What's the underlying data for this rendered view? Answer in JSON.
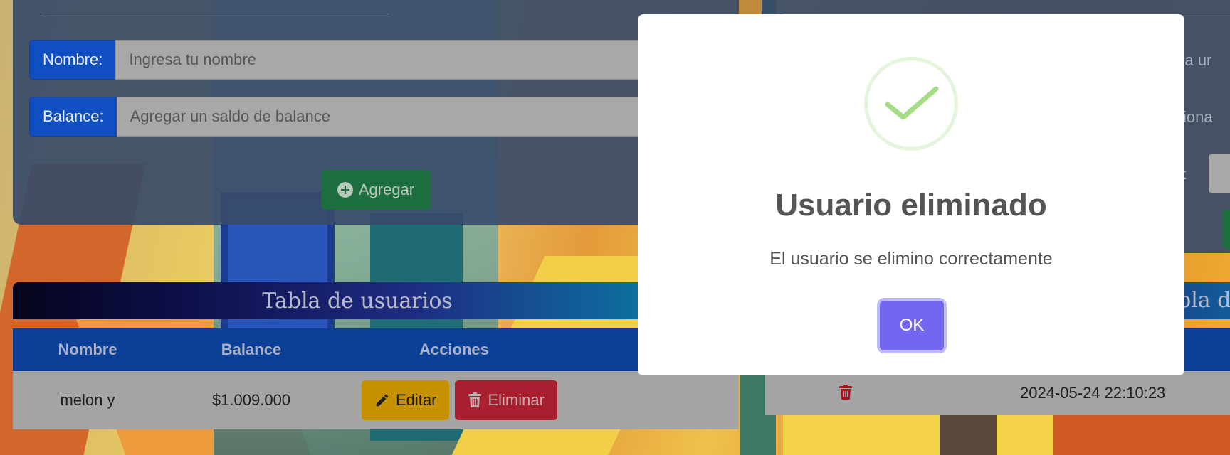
{
  "form": {
    "nombre_label": "Nombre:",
    "nombre_placeholder": "Ingresa tu nombre",
    "balance_label": "Balance:",
    "balance_placeholder": "Agregar un saldo de balance",
    "add_button": "Agregar",
    "add_icon": "plus-circle-icon"
  },
  "users_table": {
    "title": "Tabla de usuarios",
    "headers": [
      "Nombre",
      "Balance",
      "Acciones"
    ],
    "rows": [
      {
        "nombre": "melon y",
        "balance": "$1.009.000",
        "edit_label": "Editar",
        "delete_label": "Eliminar"
      }
    ]
  },
  "right_panel": {
    "peek_text_1": "ona ur",
    "peek_text_2": "cciona",
    "peek_label_suffix": ":",
    "table_title_partial": "bla d",
    "row_date": "2024-05-24 22:10:23"
  },
  "modal": {
    "icon": "success-check-icon",
    "title": "Usuario eliminado",
    "message": "El usuario se elimino correctamente",
    "ok_button": "OK"
  },
  "colors": {
    "primary": "#0f4fc2",
    "success": "#1c6e3e",
    "warning": "#c59100",
    "danger": "#a8202f",
    "modal_confirm": "#7367f0",
    "success_check": "#a5dc86"
  }
}
